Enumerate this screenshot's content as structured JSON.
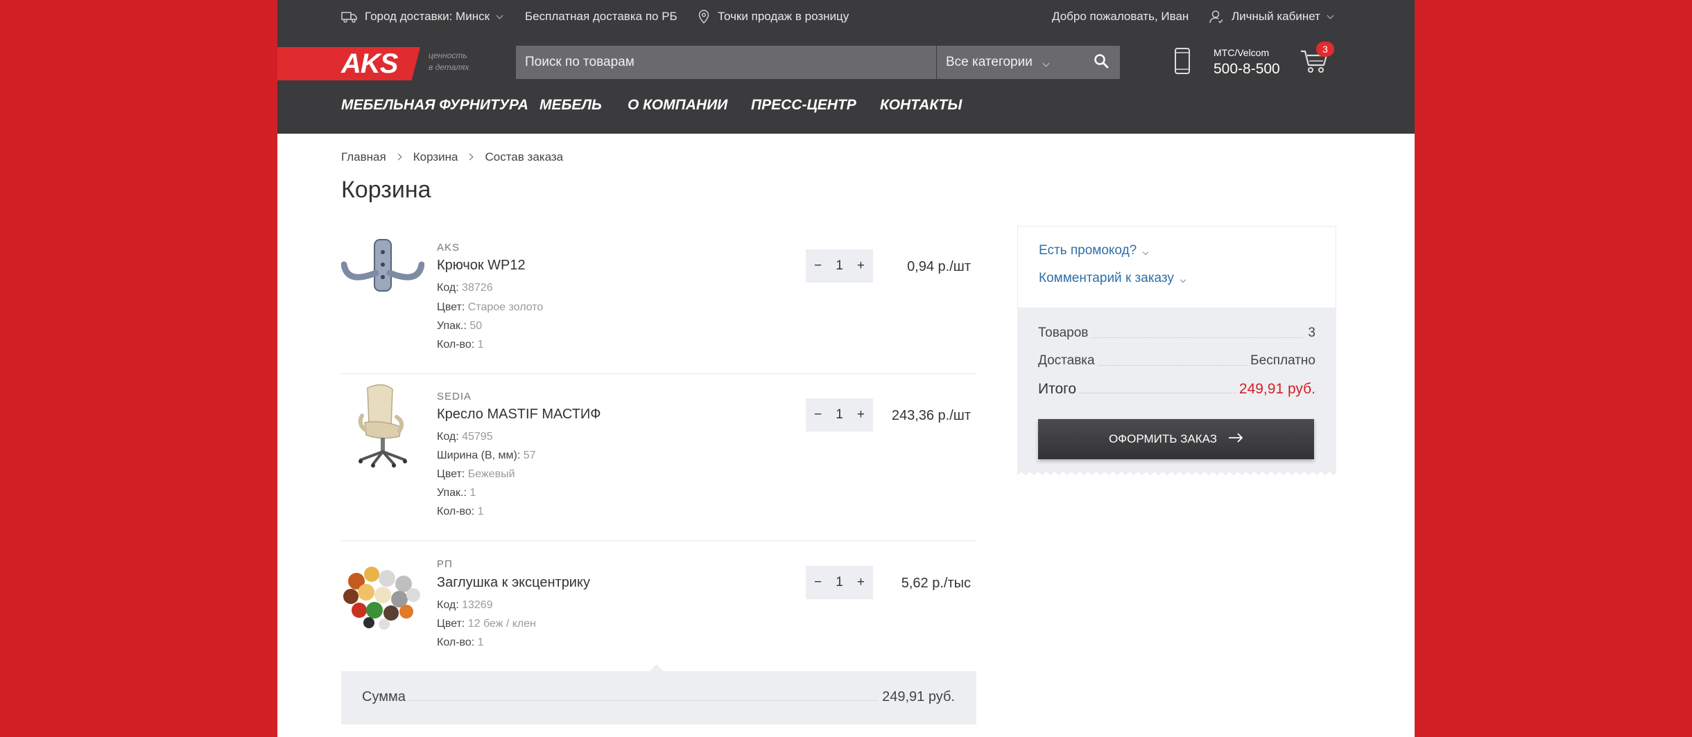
{
  "topbar": {
    "city": "Город доставки: Минск",
    "free_delivery": "Бесплатная доставка по РБ",
    "retail": "Точки продаж в розницу",
    "welcome": "Добро пожаловать, Иван",
    "account": "Личный кабинет"
  },
  "header": {
    "logo": "AKS",
    "tagline_1": "ценность",
    "tagline_2": "в деталях",
    "search_placeholder": "Поиск по товарам",
    "category": "Все категории",
    "operator": "МТС/Velcom",
    "phone": "500-8-500",
    "cart_count": "3"
  },
  "nav": {
    "items": [
      "МЕБЕЛЬНАЯ ФУРНИТУРА",
      "МЕБЕЛЬ",
      "О КОМПАНИИ",
      "ПРЕСС-ЦЕНТР",
      "КОНТАКТЫ"
    ]
  },
  "breadcrumb": [
    "Главная",
    "Корзина",
    "Состав заказа"
  ],
  "page_title": "Корзина",
  "cart": {
    "items": [
      {
        "brand": "AKS",
        "name": "Крючок WP12",
        "attrs": [
          {
            "label": "Код:",
            "value": "38726"
          },
          {
            "label": "Цвет:",
            "value": "Старое золото"
          },
          {
            "label": "Упак.:",
            "value": "50"
          },
          {
            "label": "Кол-во:",
            "value": "1"
          }
        ],
        "qty": "1",
        "price": "0,94 р./шт"
      },
      {
        "brand": "SEDIA",
        "name": "Кресло MASTIF МАСТИФ",
        "attrs": [
          {
            "label": "Код:",
            "value": "45795"
          },
          {
            "label": "Ширина (В, мм):",
            "value": "57"
          },
          {
            "label": "Цвет:",
            "value": "Бежевый"
          },
          {
            "label": "Упак.:",
            "value": "1"
          },
          {
            "label": "Кол-во:",
            "value": "1"
          }
        ],
        "qty": "1",
        "price": "243,36 р./шт"
      },
      {
        "brand": "РП",
        "name": "Заглушка к эксцентрику",
        "attrs": [
          {
            "label": "Код:",
            "value": "13269"
          },
          {
            "label": "Цвет:",
            "value": "12 беж / клен"
          },
          {
            "label": "Кол-во:",
            "value": "1"
          }
        ],
        "qty": "1",
        "price": "5,62 р./тыс"
      }
    ],
    "qty_minus": "−",
    "qty_plus": "+",
    "sum_label": "Сумма",
    "sum_value": "249,91 руб."
  },
  "summary": {
    "promo": "Есть промокод?",
    "comment": "Комментарий к заказу",
    "goods_label": "Товаров",
    "goods_value": "3",
    "delivery_label": "Доставка",
    "delivery_value": "Бесплатно",
    "total_label": "Итого",
    "total_value": "249,91 руб.",
    "checkout": "ОФОРМИТЬ ЗАКАЗ"
  },
  "colors": {
    "brand_red": "#d32027",
    "header_bg": "#3b3b3d",
    "link_blue": "#2f6ea8"
  }
}
